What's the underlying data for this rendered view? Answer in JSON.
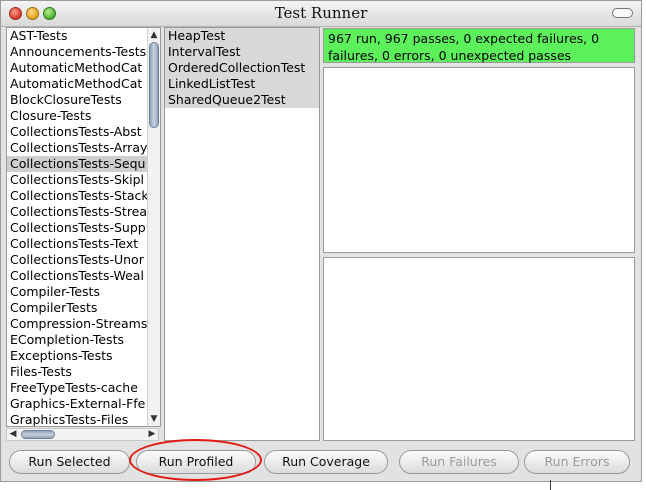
{
  "window": {
    "title": "Test Runner"
  },
  "packages": [
    "AST-Tests",
    "Announcements-Tests",
    "AutomaticMethodCat",
    "AutomaticMethodCat",
    "BlockClosureTests",
    "Closure-Tests",
    "CollectionsTests-Abst",
    "CollectionsTests-Array",
    "CollectionsTests-Sequ",
    "CollectionsTests-Skipl",
    "CollectionsTests-Stack",
    "CollectionsTests-Strea",
    "CollectionsTests-Supp",
    "CollectionsTests-Text",
    "CollectionsTests-Unor",
    "CollectionsTests-Weal",
    "Compiler-Tests",
    "CompilerTests",
    "Compression-Streams",
    "ECompletion-Tests",
    "Exceptions-Tests",
    "Files-Tests",
    "FreeTypeTests-cache",
    "Graphics-External-Ffe",
    "GraphicsTests-Files"
  ],
  "selected_package": "CollectionsTests-Sequ",
  "test_classes": [
    "HeapTest",
    "IntervalTest",
    "OrderedCollectionTest",
    "LinkedListTest",
    "SharedQueue2Test"
  ],
  "status": {
    "text": "967 run, 967 passes, 0 expected failures, 0 failures, 0 errors, 0 unexpected passes",
    "color": "#5cf15a"
  },
  "buttons": {
    "run_selected": "Run Selected",
    "run_profiled": "Run Profiled",
    "run_coverage": "Run Coverage",
    "run_failures": "Run Failures",
    "run_errors": "Run Errors"
  },
  "icons": {
    "close": "red-close-circle",
    "minimize": "yellow-minimize-circle",
    "maximize": "green-maximize-circle",
    "collapse": "toolbar-pill"
  }
}
